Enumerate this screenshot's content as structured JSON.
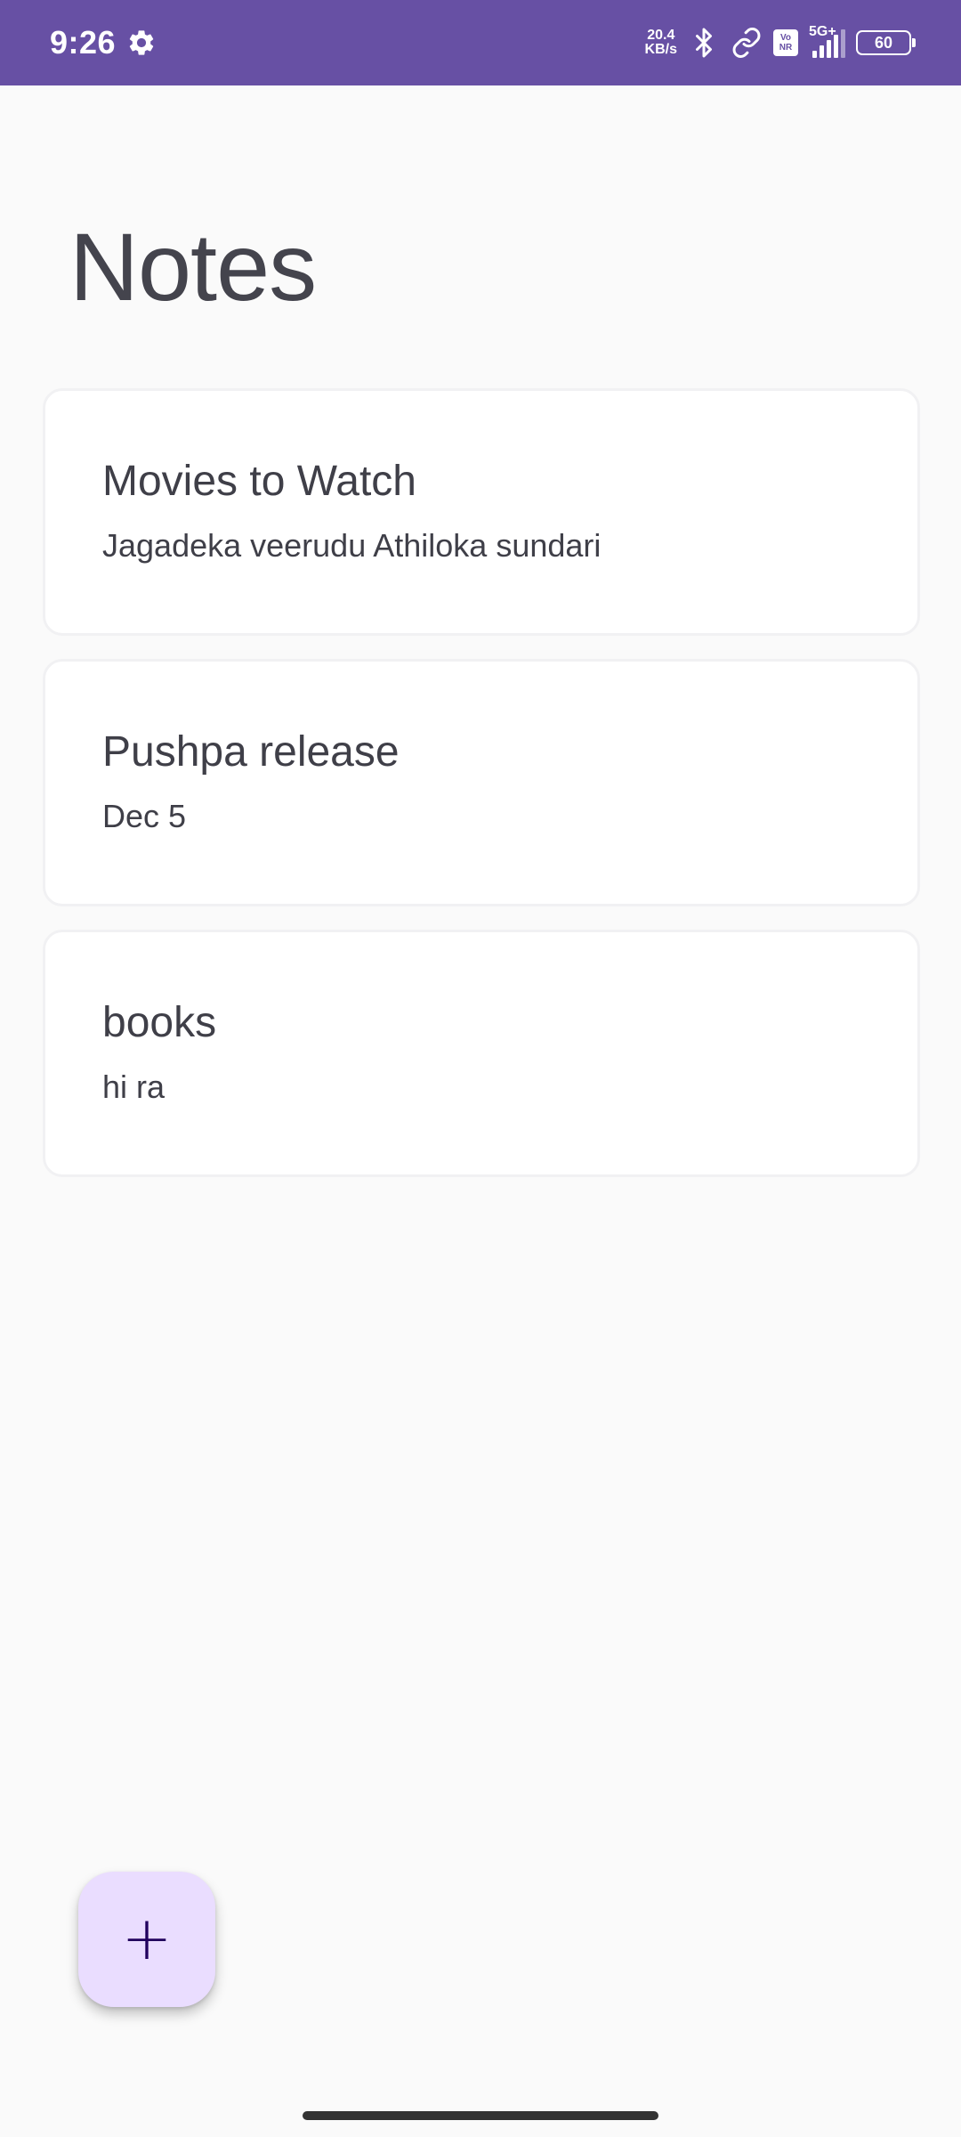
{
  "status_bar": {
    "time": "9:26",
    "net_speed_value": "20.4",
    "net_speed_unit": "KB/s",
    "volte_top": "Vo",
    "volte_bottom": "NR",
    "network_type": "5G+",
    "battery_level": "60",
    "icons": [
      "gear-icon",
      "bluetooth-icon",
      "link-icon",
      "volte-icon",
      "signal-icon",
      "battery-icon"
    ],
    "background_color": "#6750a4"
  },
  "header": {
    "title": "Notes"
  },
  "notes": [
    {
      "title": "Movies to Watch",
      "body": "Jagadeka veerudu Athiloka sundari"
    },
    {
      "title": "Pushpa release",
      "body": "Dec 5"
    },
    {
      "title": "books",
      "body": "hi ra"
    }
  ],
  "fab": {
    "icon": "+",
    "icon_name": "add-icon",
    "color": "#eaddff"
  }
}
